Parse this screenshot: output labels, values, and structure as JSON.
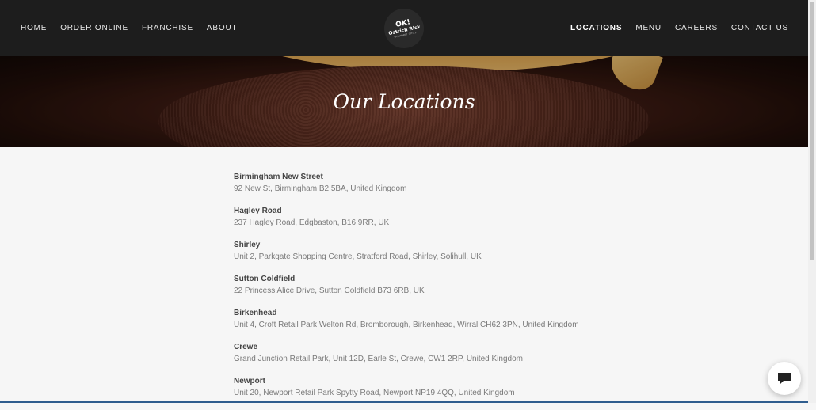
{
  "nav": {
    "left": [
      {
        "label": "HOME"
      },
      {
        "label": "ORDER ONLINE"
      },
      {
        "label": "FRANCHISE"
      },
      {
        "label": "ABOUT"
      }
    ],
    "right": [
      {
        "label": "LOCATIONS",
        "active": true
      },
      {
        "label": "MENU"
      },
      {
        "label": "CAREERS"
      },
      {
        "label": "CONTACT US"
      }
    ]
  },
  "logo": {
    "line1": "OK!",
    "line2": "Ostrich Rick",
    "line3": "GOURMET GRILL"
  },
  "hero": {
    "title": "Our Locations"
  },
  "locations": [
    {
      "name": "Birmingham New Street",
      "address": "92 New St, Birmingham B2 5BA, United Kingdom"
    },
    {
      "name": "Hagley Road",
      "address": "237 Hagley Road, Edgbaston, B16 9RR, UK"
    },
    {
      "name": "Shirley",
      "address": "Unit 2, Parkgate Shopping Centre, Stratford Road, Shirley, Solihull, UK"
    },
    {
      "name": "Sutton Coldfield",
      "address": "22 Princess Alice Drive, Sutton Coldfield B73 6RB, UK"
    },
    {
      "name": "Birkenhead",
      "address": "Unit 4, Croft Retail Park Welton Rd, Bromborough, Birkenhead, Wirral CH62 3PN, United Kingdom"
    },
    {
      "name": "Crewe",
      "address": "Grand Junction Retail Park, Unit 12D, Earle St, Crewe, CW1 2RP, United Kingdom"
    },
    {
      "name": "Newport",
      "address": "Unit 20, Newport Retail Park Spytty Road, Newport NP19 4QQ, United Kingdom"
    }
  ],
  "chat": {
    "icon": "chat-bubble-icon"
  },
  "colors": {
    "header_bg": "#1d1d1d",
    "page_bg": "#f6f6f6",
    "accent_line": "#2f5d8e"
  }
}
